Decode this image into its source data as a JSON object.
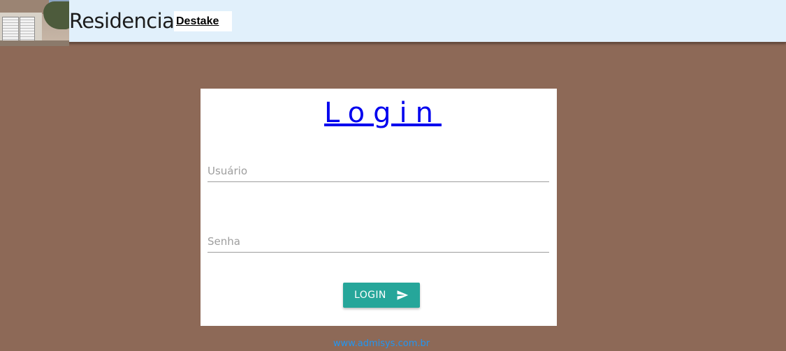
{
  "header": {
    "title": "Residencial",
    "badge": "Destake",
    "background_color": "#e1f0fb"
  },
  "login": {
    "title": "Login",
    "username_placeholder": "Usuário",
    "username_value": "",
    "password_placeholder": "Senha",
    "password_value": "",
    "button_label": "LOGIN",
    "button_icon": "send-icon",
    "button_color": "#26a69a",
    "title_color": "#0000ee"
  },
  "footer": {
    "link_text": "www.admisys.com.br",
    "link_color": "#2196f3"
  },
  "page": {
    "background_color": "#8d6957"
  }
}
